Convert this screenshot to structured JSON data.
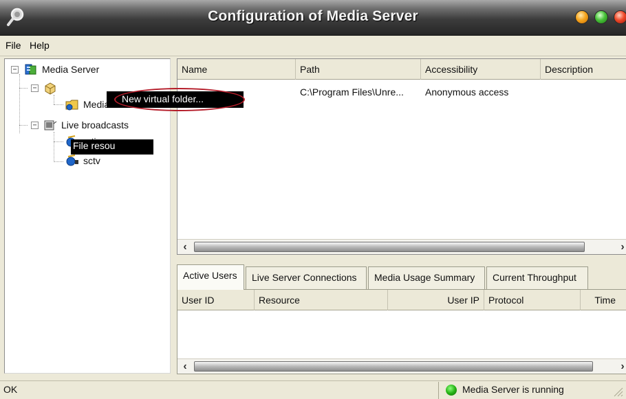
{
  "window": {
    "title": "Configuration of Media Server",
    "title_icon": "magnifier-icon"
  },
  "menu": {
    "file": "File",
    "help": "Help"
  },
  "tree": {
    "root": "Media Server",
    "file_resources": "File resou",
    "media_folder": "Media",
    "live_broadcasts": "Live broadcasts",
    "channels": [
      "rcti",
      "sctv"
    ]
  },
  "context_menu": {
    "item": "New virtual folder..."
  },
  "resources_table": {
    "columns": [
      "Name",
      "Path",
      "Accessibility",
      "Description"
    ],
    "rows": [
      {
        "name": "",
        "path": "C:\\Program Files\\Unre...",
        "accessibility": "Anonymous access",
        "description": ""
      }
    ]
  },
  "tabs": [
    "Active Users",
    "Live Server Connections",
    "Media Usage Summary",
    "Current Throughput"
  ],
  "active_tab": "Active Users",
  "users_table": {
    "columns": [
      "User ID",
      "Resource",
      "User IP",
      "Protocol",
      "Time"
    ]
  },
  "status": {
    "left": "OK",
    "right": "Media Server is running",
    "indicator_color": "#26b316"
  },
  "colors": {
    "window_bg": "#ece9d8",
    "titlebar": "#262626",
    "context_menu_bg": "#000000",
    "highlight_ring": "#b51d2a"
  }
}
